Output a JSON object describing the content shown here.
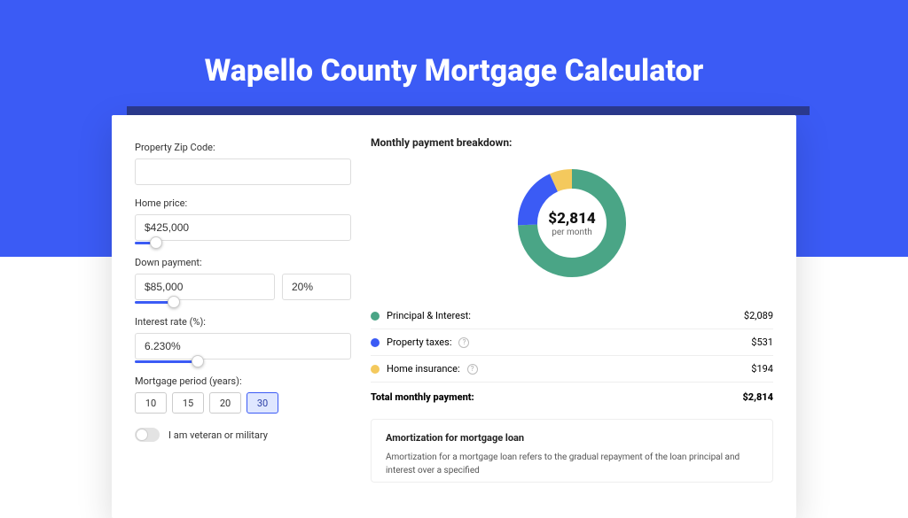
{
  "title": "Wapello County Mortgage Calculator",
  "form": {
    "zip_label": "Property Zip Code:",
    "zip_value": "",
    "home_price_label": "Home price:",
    "home_price_value": "$425,000",
    "home_price_slider_pct": 10,
    "down_payment_label": "Down payment:",
    "down_payment_value": "$85,000",
    "down_payment_pct_value": "20%",
    "down_payment_slider_pct": 28,
    "interest_label": "Interest rate (%):",
    "interest_value": "6.230%",
    "interest_slider_pct": 45,
    "period_label": "Mortgage period (years):",
    "period_options": [
      "10",
      "15",
      "20",
      "30"
    ],
    "period_selected": "30",
    "veteran_label": "I am veteran or military"
  },
  "breakdown": {
    "heading": "Monthly payment breakdown:",
    "center_value": "$2,814",
    "center_sub": "per month",
    "rows": [
      {
        "name": "Principal & Interest:",
        "color": "#4aa586",
        "value": "$2,089",
        "info": false
      },
      {
        "name": "Property taxes:",
        "color": "#3b5bf5",
        "value": "$531",
        "info": true
      },
      {
        "name": "Home insurance:",
        "color": "#f4c95d",
        "value": "$194",
        "info": true
      }
    ],
    "total_label": "Total monthly payment:",
    "total_value": "$2,814"
  },
  "chart_data": {
    "type": "pie",
    "title": "Monthly payment breakdown",
    "categories": [
      "Principal & Interest",
      "Property taxes",
      "Home insurance"
    ],
    "values": [
      2089,
      531,
      194
    ],
    "colors": [
      "#4aa586",
      "#3b5bf5",
      "#f4c95d"
    ],
    "total": 2814
  },
  "amortization": {
    "heading": "Amortization for mortgage loan",
    "body": "Amortization for a mortgage loan refers to the gradual repayment of the loan principal and interest over a specified"
  }
}
